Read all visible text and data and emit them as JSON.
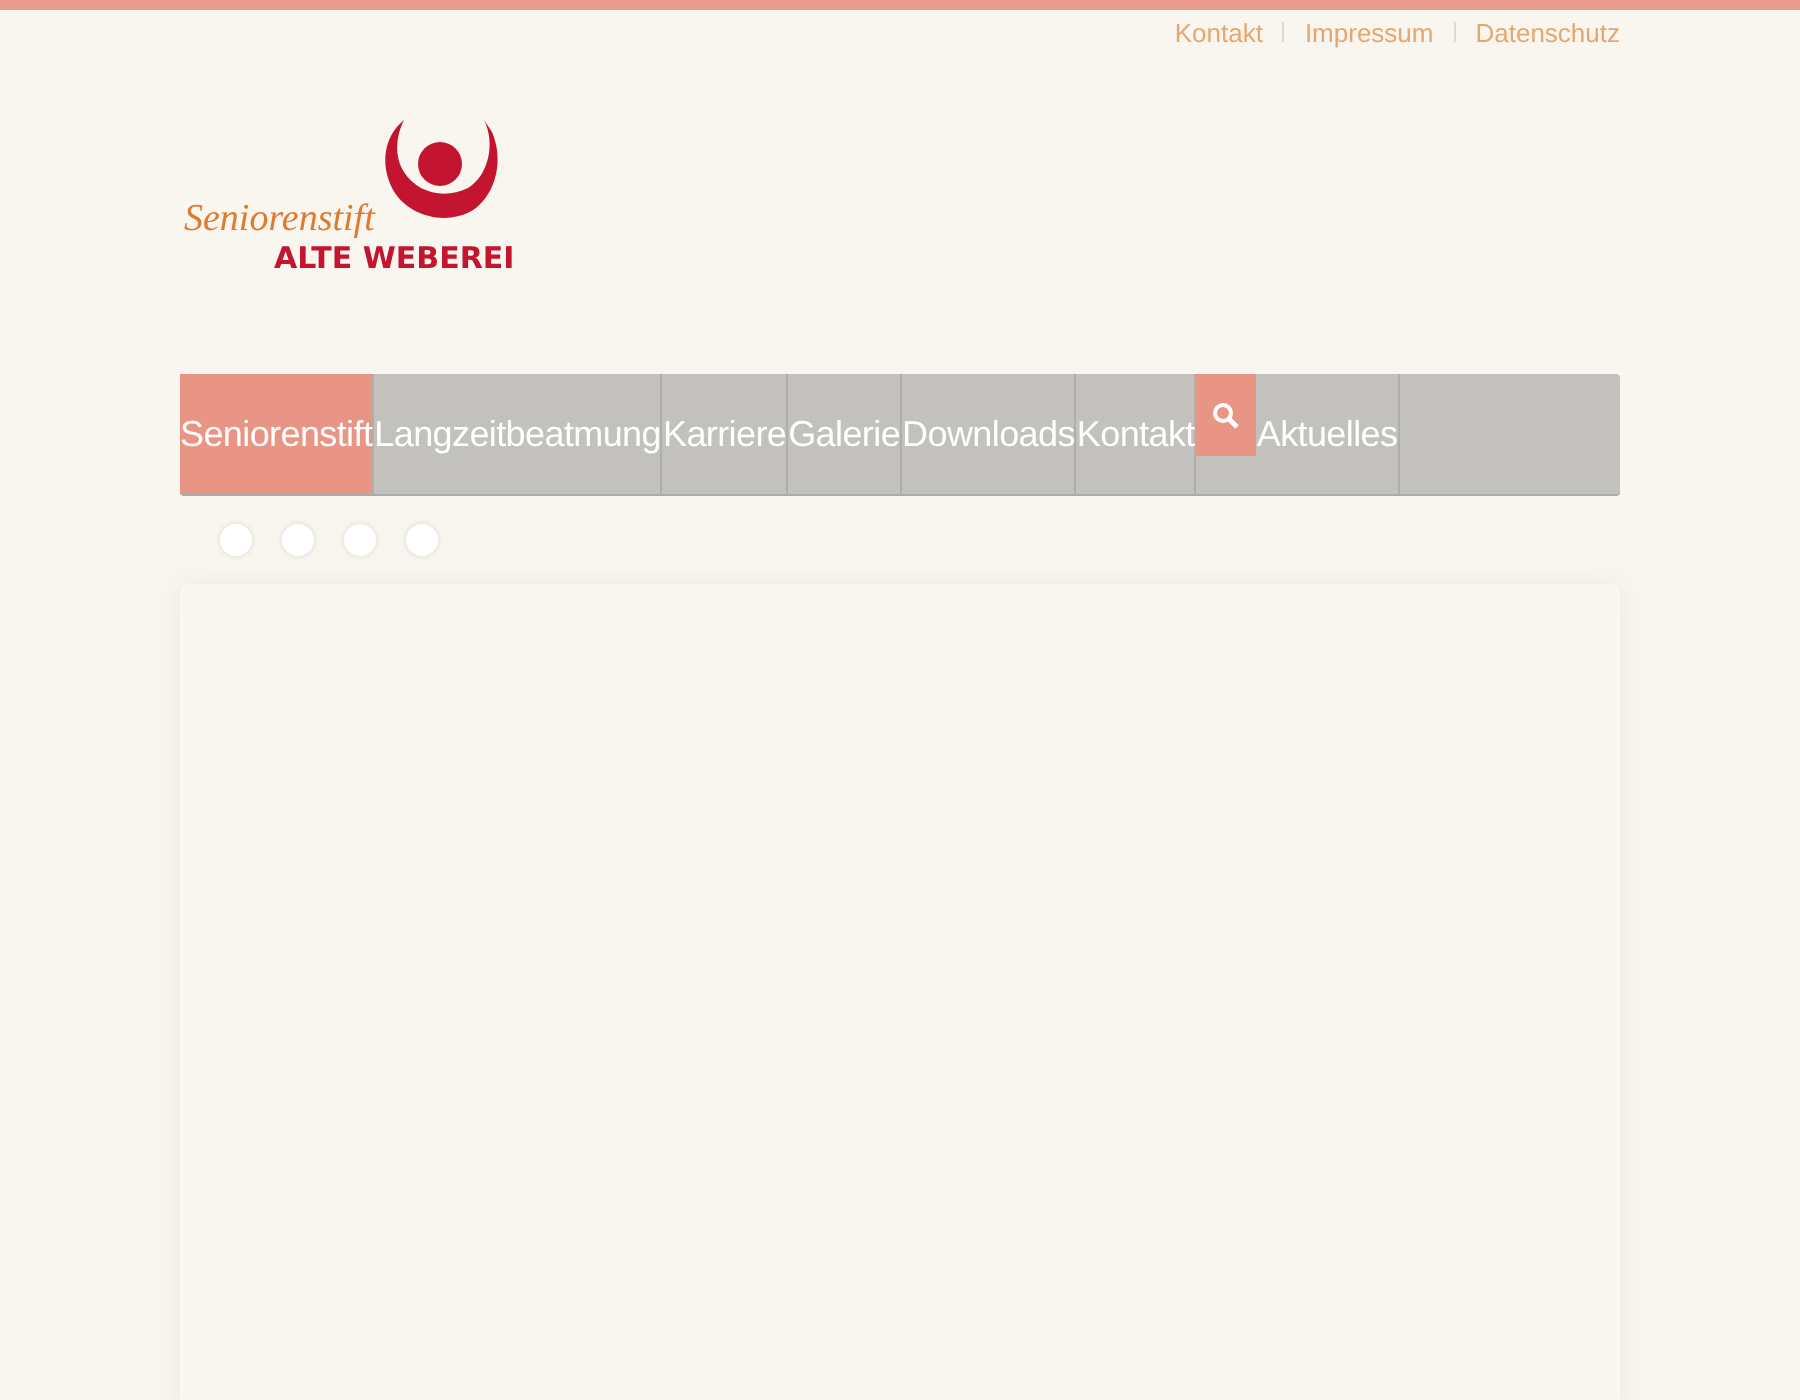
{
  "top_links": [
    "Kontakt",
    "Impressum",
    "Datenschutz"
  ],
  "logo": {
    "line_1": "Seniorenstift",
    "line_2": "ALTE WEBEREI"
  },
  "nav": [
    {
      "label": "Seniorenstift",
      "selected": true
    },
    {
      "label": "Langzeitbeatmung",
      "selected": false
    },
    {
      "label": "Karriere",
      "selected": false
    },
    {
      "label": "Galerie",
      "selected": false
    },
    {
      "label": "Downloads",
      "selected": false
    },
    {
      "label": "Kontakt",
      "selected": false
    },
    {
      "label": "Aktuelles",
      "selected": false
    }
  ]
}
